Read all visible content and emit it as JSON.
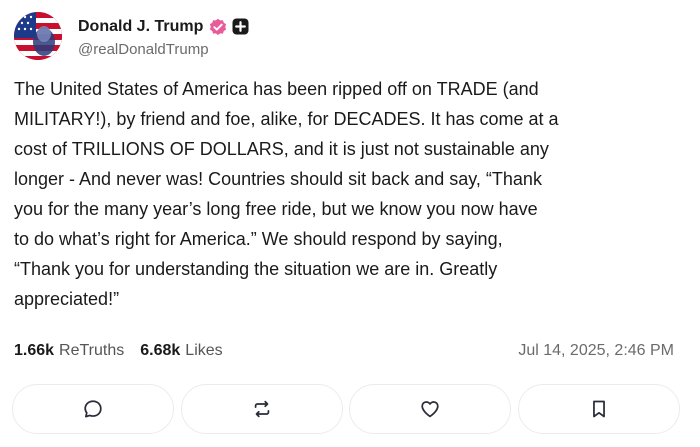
{
  "author": {
    "display_name": "Donald J. Trump",
    "handle": "@realDonaldTrump",
    "verified_badge_color": "#e85c9c"
  },
  "post": {
    "lines": [
      "The United States of America has been ripped off on TRADE (and",
      "MILITARY!), by friend and foe, alike, for DECADES. It has come at a",
      "cost of TRILLIONS OF DOLLARS, and it is just not sustainable any",
      "longer - And never was! Countries should sit back and say, “Thank",
      "you for the many year’s long free ride, but we know you now have",
      "to do what’s right for America.” We should respond by saying,",
      "“Thank you for understanding the situation we are in. Greatly",
      "appreciated!”"
    ]
  },
  "stats": {
    "retruths_count": "1.66k",
    "retruths_label": "ReTruths",
    "likes_count": "6.68k",
    "likes_label": "Likes"
  },
  "timestamp": "Jul 14, 2025, 2:46 PM",
  "actions": [
    {
      "icon": "reply-icon"
    },
    {
      "icon": "retruth-icon"
    },
    {
      "icon": "like-icon"
    },
    {
      "icon": "bookmark-icon"
    }
  ]
}
